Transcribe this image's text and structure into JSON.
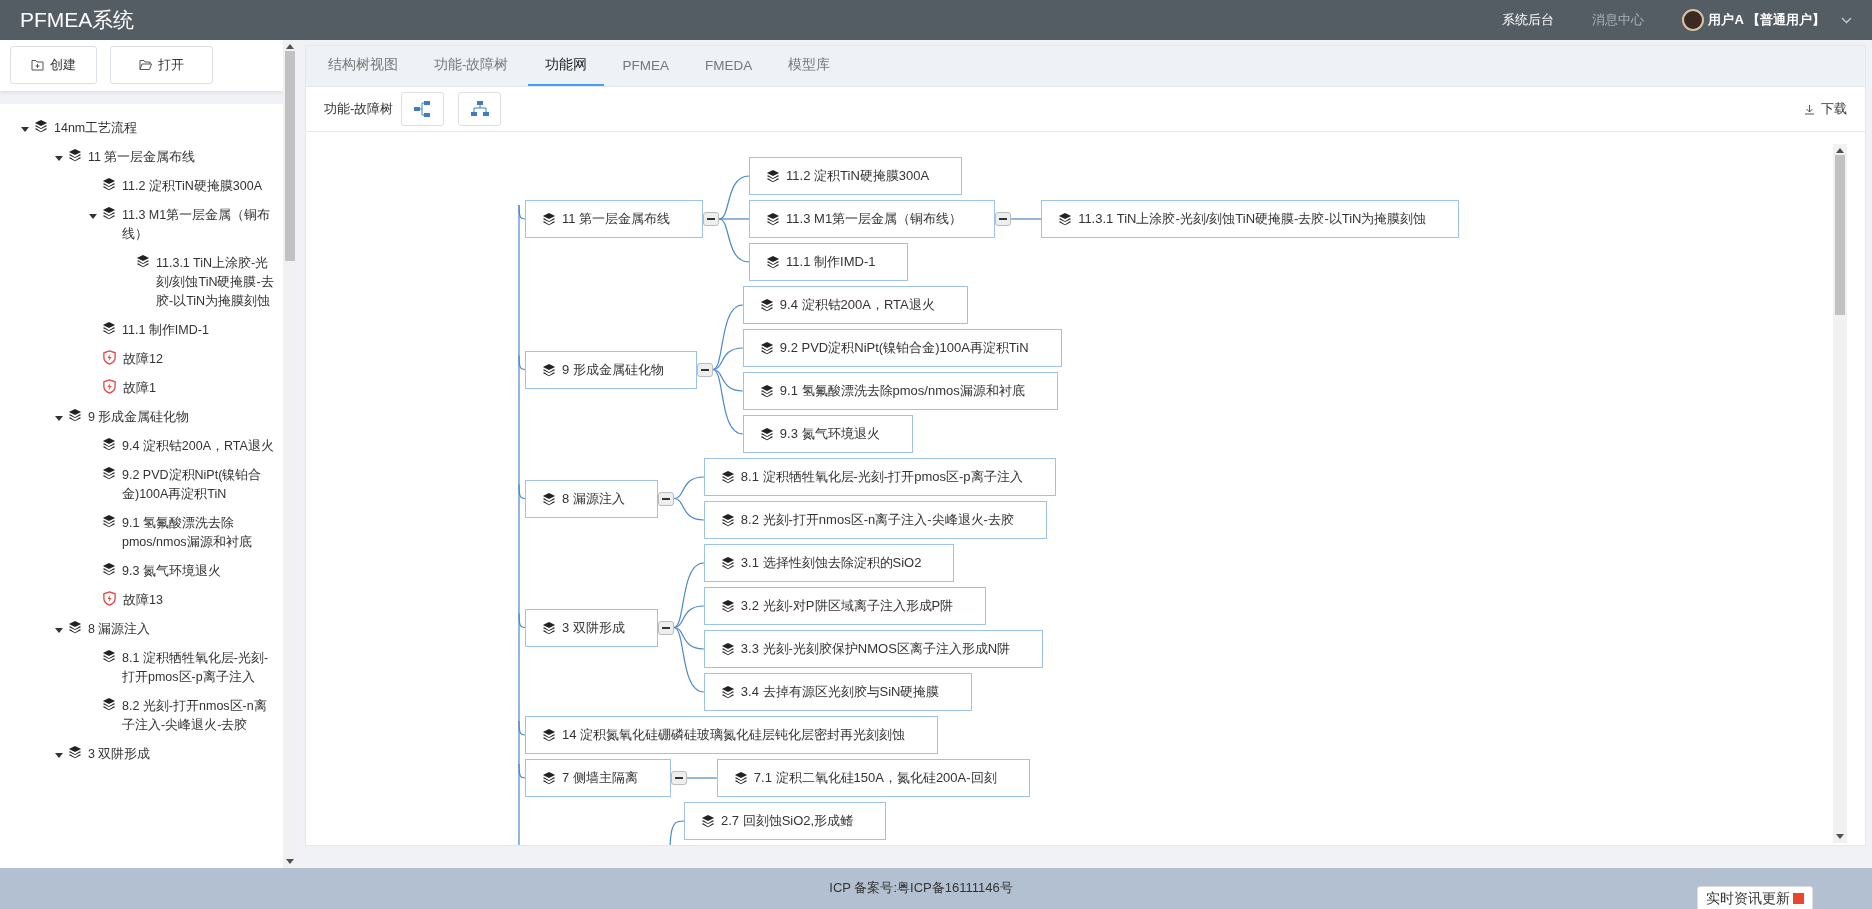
{
  "header": {
    "title": "PFMEA系统",
    "links": [
      {
        "label": "系统后台",
        "kind": "active"
      },
      {
        "label": "消息中心",
        "kind": "muted"
      }
    ],
    "user": "用户A 【普通用户】"
  },
  "sidebar": {
    "buttons": [
      {
        "label": "创建",
        "kind": "create"
      },
      {
        "label": "打开",
        "kind": "open"
      }
    ],
    "tree": [
      {
        "label": "14nm工艺流程",
        "kind": "step",
        "expanded": true,
        "children": [
          {
            "label": "11 第一层金属布线",
            "kind": "step",
            "expanded": true,
            "children": [
              {
                "label": "11.2 淀积TiN硬掩膜300A",
                "kind": "step"
              },
              {
                "label": "11.3 M1第一层金属（铜布线）",
                "kind": "step",
                "expanded": true,
                "children": [
                  {
                    "label": "11.3.1 TiN上涂胶-光刻/刻蚀TiN硬掩膜-去胶-以TiN为掩膜刻蚀",
                    "kind": "step"
                  }
                ]
              },
              {
                "label": "11.1 制作IMD-1",
                "kind": "step"
              },
              {
                "label": "故障12",
                "kind": "fault"
              },
              {
                "label": "故障1",
                "kind": "fault"
              }
            ]
          },
          {
            "label": "9 形成金属硅化物",
            "kind": "step",
            "expanded": true,
            "children": [
              {
                "label": "9.4 淀积钴200A，RTA退火",
                "kind": "step"
              },
              {
                "label": "9.2 PVD淀积NiPt(镍铂合金)100A再淀积TiN",
                "kind": "step"
              },
              {
                "label": "9.1 氢氟酸漂洗去除pmos/nmos漏源和衬底",
                "kind": "step"
              },
              {
                "label": "9.3 氮气环境退火",
                "kind": "step"
              },
              {
                "label": "故障13",
                "kind": "fault"
              }
            ]
          },
          {
            "label": "8 漏源注入",
            "kind": "step",
            "expanded": true,
            "children": [
              {
                "label": "8.1 淀积牺牲氧化层-光刻-打开pmos区-p离子注入",
                "kind": "step"
              },
              {
                "label": "8.2 光刻-打开nmos区-n离子注入-尖峰退火-去胶",
                "kind": "step"
              }
            ]
          },
          {
            "label": "3 双阱形成",
            "kind": "step",
            "expanded": true
          }
        ]
      }
    ]
  },
  "tabs": [
    {
      "label": "结构树视图",
      "selected": false
    },
    {
      "label": "功能-故障树",
      "selected": false
    },
    {
      "label": "功能网",
      "selected": true
    },
    {
      "label": "PFMEA",
      "selected": false
    },
    {
      "label": "FMEDA",
      "selected": false
    },
    {
      "label": "模型库",
      "selected": false
    }
  ],
  "toolbar": {
    "label": "功能-故障树",
    "download": "下载"
  },
  "mindmap": {
    "nodes": [
      {
        "kind": "node",
        "label": "11 第一层金属布线",
        "expanded": true,
        "children": [
          {
            "label": "11.2 淀积TiN硬掩膜300A"
          },
          {
            "label": "11.3 M1第一层金属（铜布线）",
            "expanded": true,
            "children": [
              {
                "label": "11.3.1 TiN上涂胶-光刻/刻蚀TiN硬掩膜-去胶-以TiN为掩膜刻蚀"
              }
            ]
          },
          {
            "label": "11.1 制作IMD-1"
          }
        ]
      },
      {
        "kind": "node",
        "label": "9 形成金属硅化物",
        "expanded": true,
        "children": [
          {
            "label": "9.4 淀积钴200A，RTA退火"
          },
          {
            "label": "9.2 PVD淀积NiPt(镍铂合金)100A再淀积TiN"
          },
          {
            "label": "9.1 氢氟酸漂洗去除pmos/nmos漏源和衬底"
          },
          {
            "label": "9.3 氮气环境退火"
          }
        ]
      },
      {
        "kind": "node",
        "label": "8 漏源注入",
        "expanded": true,
        "children": [
          {
            "label": "8.1 淀积牺牲氧化层-光刻-打开pmos区-p离子注入"
          },
          {
            "label": "8.2 光刻-打开nmos区-n离子注入-尖峰退火-去胶"
          }
        ]
      },
      {
        "kind": "node",
        "label": "3 双阱形成",
        "expanded": true,
        "children": [
          {
            "label": "3.1 选择性刻蚀去除淀积的SiO2"
          },
          {
            "label": "3.2 光刻-对P阱区域离子注入形成P阱"
          },
          {
            "label": "3.3 光刻-光刻胶保护NMOS区离子注入形成N阱"
          },
          {
            "label": "3.4 去掉有源区光刻胶与SiN硬掩膜"
          }
        ]
      },
      {
        "kind": "node",
        "label": "14 淀积氮氧化硅硼磷硅玻璃氮化硅层钝化层密封再光刻刻蚀"
      },
      {
        "kind": "node",
        "label": "7 侧墙主隔离",
        "expanded": true,
        "children": [
          {
            "label": "7.1 淀积二氧化硅150A，氮化硅200A-回刻"
          }
        ]
      },
      {
        "kind": "subnode",
        "label": "2.7 回刻蚀SiO2,形成鳍"
      }
    ]
  },
  "footer": {
    "text": "ICP 备案号:粤ICP备16111146号",
    "badge": "实时资讯更新"
  }
}
